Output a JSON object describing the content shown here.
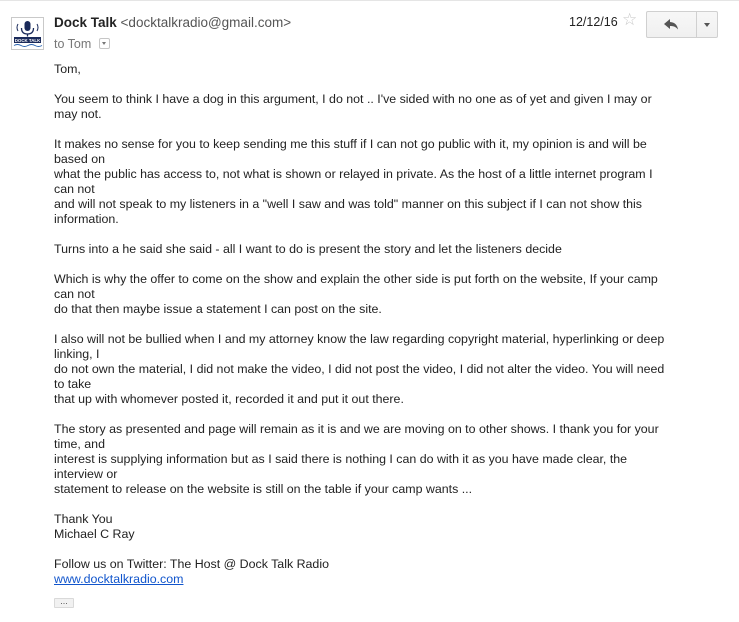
{
  "header": {
    "sender_name": "Dock Talk",
    "sender_email": "<docktalkradio@gmail.com>",
    "recipient": "to Tom",
    "date": "12/12/16",
    "avatar_text": "DOCK TALK",
    "star_icon": "star-outline-icon",
    "reply_icon": "reply-arrow-icon",
    "more_icon": "chevron-down-icon"
  },
  "message": {
    "greeting": "Tom,",
    "p1": "You seem to think I have a dog in this argument, I do not .. I've sided with no one as of yet and given I may or\nmay not.",
    "p2": "It makes no sense for you to keep sending me this stuff if I can not go public with it, my opinion is and will be\nbased on\nwhat the public has access to, not what is shown or relayed in private. As the host of a little internet program I\ncan not\nand will not speak to my listeners in a \"well I saw and was told\" manner on this subject if I can not show this\ninformation.",
    "p3": "Turns into a he said she said - all I want to do is present the story and let the listeners decide",
    "p4": "Which is why the offer to come on the show and explain the other side is put forth on the website, If your camp\ncan not\ndo that then maybe issue a statement I can post on the site.",
    "p5": "I also will not be bullied when I and my attorney know the law regarding copyright material, hyperlinking or deep\nlinking, I\ndo not own the material, I did not make the video, I did not post the video, I did not alter the video. You will need\nto take\nthat up with whomever posted it, recorded it and put it out there.",
    "p6": "The story as presented and page will remain as it is and we are moving on to other shows. I thank you for your\ntime, and\ninterest is supplying information but as I said there is nothing I can do with it as you have made clear, the\ninterview or\nstatement to release on the website is still on the table if your camp wants ...",
    "signoff": "Thank You",
    "signature": "Michael C Ray",
    "follow": "Follow us on Twitter: The Host @ Dock Talk Radio",
    "website": "www.docktalkradio.com"
  },
  "trimmed_content_label": "..."
}
